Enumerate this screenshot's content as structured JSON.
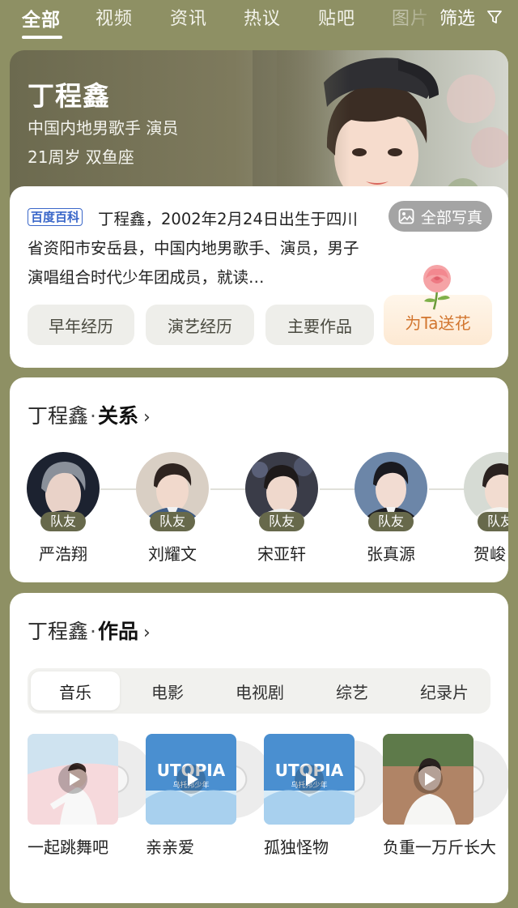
{
  "nav": {
    "tabs": [
      "全部",
      "视频",
      "资讯",
      "热议",
      "贴吧",
      "图片"
    ],
    "active": "全部",
    "filter_label": "筛选"
  },
  "profile": {
    "name": "丁程鑫",
    "occupation": "中国内地男歌手  演员",
    "age_sign": "21周岁  双鱼座",
    "album_button": "全部写真",
    "baike_tag": "百度百科",
    "description": "丁程鑫，2002年2月24日出生于四川省资阳市安岳县，中国内地男歌手、演员，男子演唱组合时代少年团成员，就读…",
    "sections": [
      "早年经历",
      "演艺经历",
      "主要作品"
    ],
    "flower_button": "为Ta送花"
  },
  "relations": {
    "title_name": "丁程鑫",
    "title_dot": "·",
    "title_keyword": "关系",
    "people": [
      {
        "name": "严浩翔",
        "role": "队友"
      },
      {
        "name": "刘耀文",
        "role": "队友"
      },
      {
        "name": "宋亚轩",
        "role": "队友"
      },
      {
        "name": "张真源",
        "role": "队友"
      },
      {
        "name": "贺峻",
        "role": "队友"
      }
    ]
  },
  "works": {
    "title_name": "丁程鑫",
    "title_dot": "·",
    "title_keyword": "作品",
    "tabs": [
      "音乐",
      "电影",
      "电视剧",
      "综艺",
      "纪录片"
    ],
    "active_tab": "音乐",
    "items": [
      {
        "title": "一起跳舞吧"
      },
      {
        "title": "亲亲爱"
      },
      {
        "title": "孤独怪物"
      },
      {
        "title": "负重一万斤长大"
      }
    ],
    "cover_text": "UTOPIA",
    "cover_subtext": "乌托邦少年"
  },
  "colors": {
    "background": "#8e9064",
    "badge": "#67694b",
    "baike_blue": "#3a67c9",
    "flower_orange": "#d2762f"
  }
}
